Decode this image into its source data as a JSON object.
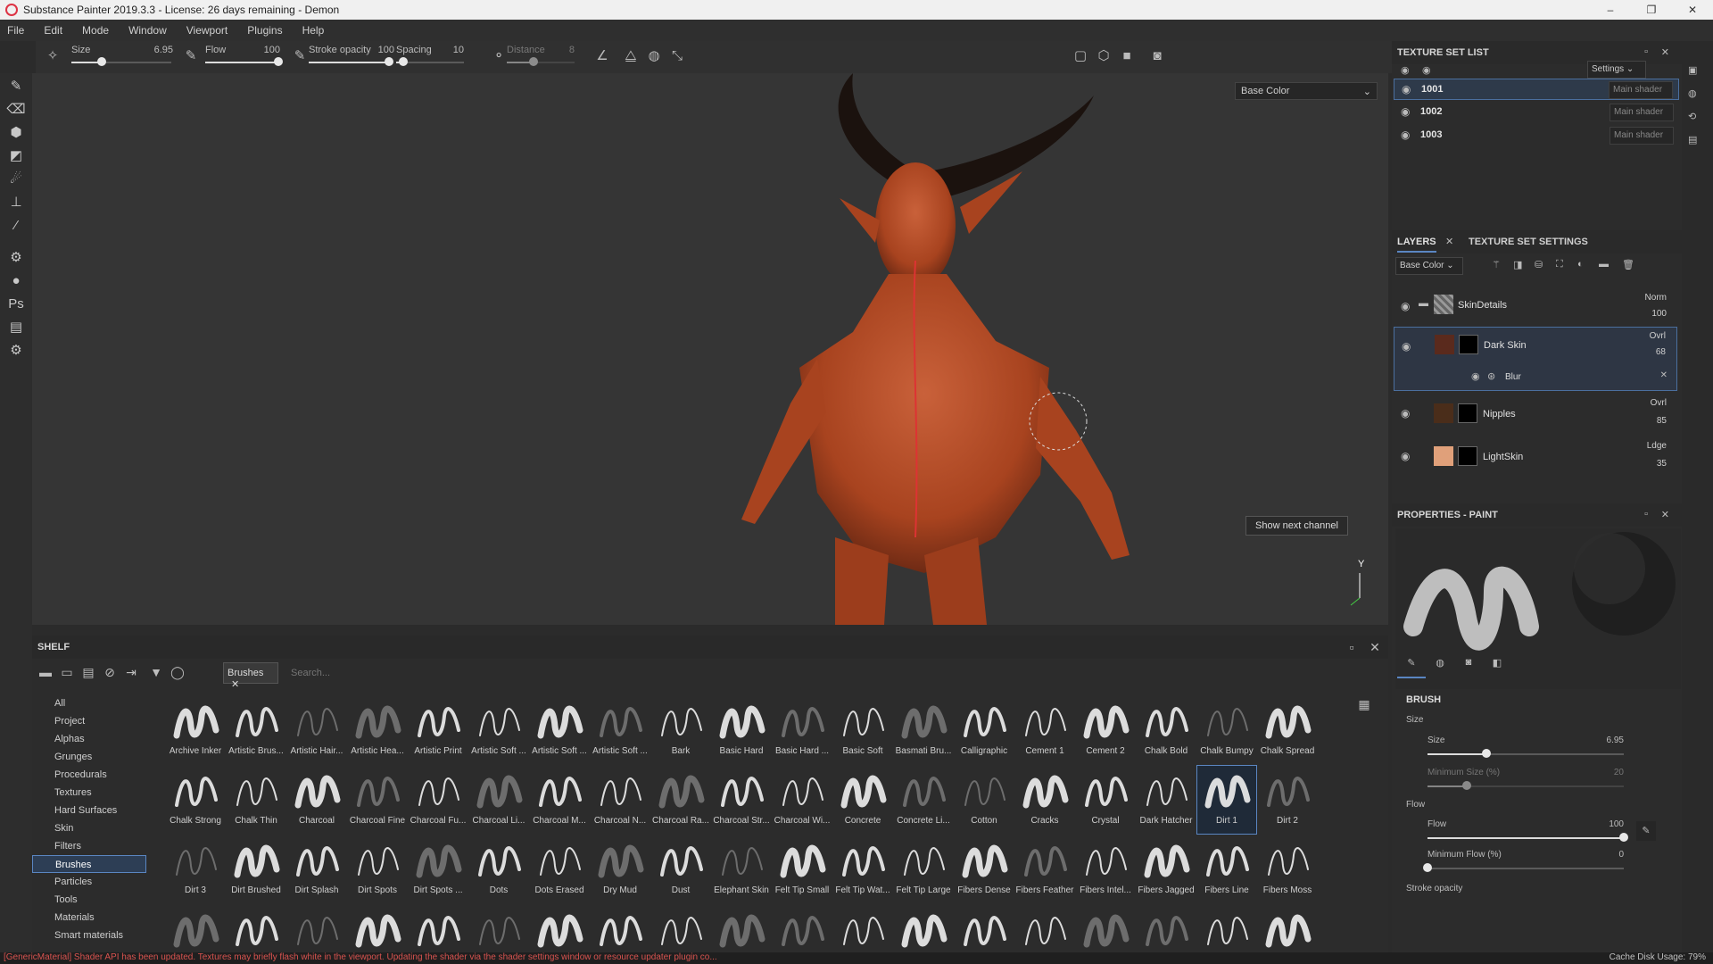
{
  "window": {
    "title": "Substance Painter 2019.3.3 - License: 26 days remaining - Demon",
    "controls": [
      "–",
      "❐",
      "✕"
    ]
  },
  "menu": [
    "File",
    "Edit",
    "Mode",
    "Window",
    "Viewport",
    "Plugins",
    "Help"
  ],
  "toolbar": {
    "size_label": "Size",
    "size_value": "6.95",
    "size_level": 0.3,
    "flow_label": "Flow",
    "flow_value": "100",
    "flow_level": 1.0,
    "stroke_opacity_label": "Stroke opacity",
    "stroke_opacity_value": "100",
    "stroke_opacity_level": 1.0,
    "spacing_label": "Spacing",
    "spacing_value": "10",
    "spacing_level": 0.1,
    "distance_label": "Distance",
    "distance_value": "8",
    "distance_level": 0.4
  },
  "viewport": {
    "channel": "Base Color",
    "tooltip": "Show next channel",
    "axis_label": "Y"
  },
  "shelf": {
    "title": "SHELF",
    "filter_chip": "Brushes",
    "search_placeholder": "Search...",
    "categories": [
      "All",
      "Project",
      "Alphas",
      "Grunges",
      "Procedurals",
      "Textures",
      "Hard Surfaces",
      "Skin",
      "Filters",
      "Brushes",
      "Particles",
      "Tools",
      "Materials",
      "Smart materials"
    ],
    "selected_category": "Brushes",
    "brushes": [
      "Archive Inker",
      "Artistic Brus...",
      "Artistic Hair...",
      "Artistic Hea...",
      "Artistic Print",
      "Artistic Soft ...",
      "Artistic Soft ...",
      "Artistic Soft ...",
      "Bark",
      "Basic Hard",
      "Basic Hard ...",
      "Basic Soft",
      "Basmati Bru...",
      "Calligraphic",
      "Cement 1",
      "Cement 2",
      "Chalk Bold",
      "Chalk Bumpy",
      "Chalk Spread",
      "Chalk Strong",
      "Chalk Thin",
      "Charcoal",
      "Charcoal Fine",
      "Charcoal Fu...",
      "Charcoal Li...",
      "Charcoal M...",
      "Charcoal N...",
      "Charcoal Ra...",
      "Charcoal Str...",
      "Charcoal Wi...",
      "Concrete",
      "Concrete Li...",
      "Cotton",
      "Cracks",
      "Crystal",
      "Dark Hatcher",
      "Dirt 1",
      "Dirt 2",
      "Dirt 3",
      "Dirt Brushed",
      "Dirt Splash",
      "Dirt Spots",
      "Dirt Spots ...",
      "Dots",
      "Dots Erased",
      "Dry Mud",
      "Dust",
      "Elephant Skin",
      "Felt Tip Small",
      "Felt Tip Wat...",
      "Felt Tip Large",
      "Fibers Dense",
      "Fibers Feather",
      "Fibers Intel...",
      "Fibers Jagged",
      "Fibers Line",
      "Fibers Moss",
      "",
      "",
      "",
      "",
      "",
      "",
      "",
      "",
      "",
      "",
      "",
      "",
      "",
      "",
      "",
      "",
      "",
      "",
      ""
    ],
    "selected_brush": "Dirt 1"
  },
  "texture_set_list": {
    "title": "TEXTURE SET LIST",
    "settings_label": "Settings",
    "sets": [
      {
        "name": "1001",
        "shader": "Main shader"
      },
      {
        "name": "1002",
        "shader": "Main shader"
      },
      {
        "name": "1003",
        "shader": "Main shader"
      }
    ]
  },
  "layers_panel": {
    "tab_layers": "LAYERS",
    "tab_texture_settings": "TEXTURE SET SETTINGS",
    "channel": "Base Color",
    "layers": [
      {
        "name": "SkinDetails",
        "blend": "Norm",
        "opacity": "100"
      },
      {
        "name": "Dark Skin",
        "blend": "Ovrl",
        "opacity": "68",
        "effect": "Blur"
      },
      {
        "name": "Nipples",
        "blend": "Ovrl",
        "opacity": "85"
      },
      {
        "name": "LightSkin",
        "blend": "Ldge",
        "opacity": "35"
      }
    ]
  },
  "properties": {
    "title": "PROPERTIES - PAINT",
    "brush_section": "BRUSH",
    "size_group": "Size",
    "size_label": "Size",
    "size_value": "6.95",
    "size_level": 0.3,
    "min_size_label": "Minimum Size (%)",
    "min_size_value": "20",
    "min_size_level": 0.2,
    "flow_group": "Flow",
    "flow_label": "Flow",
    "flow_value": "100",
    "flow_level": 1.0,
    "min_flow_label": "Minimum Flow (%)",
    "min_flow_value": "0",
    "min_flow_level": 0.0,
    "stroke_opacity_label": "Stroke opacity"
  },
  "status": {
    "message": "[GenericMaterial] Shader API has been updated. Textures may briefly flash white in the viewport. Updating the shader via the shader settings window or resource updater plugin co...",
    "cache": "Cache Disk Usage:  79%"
  },
  "colors": {
    "accent": "#5a86c2",
    "status_error": "#d8534f",
    "skin": "#b44a28"
  }
}
